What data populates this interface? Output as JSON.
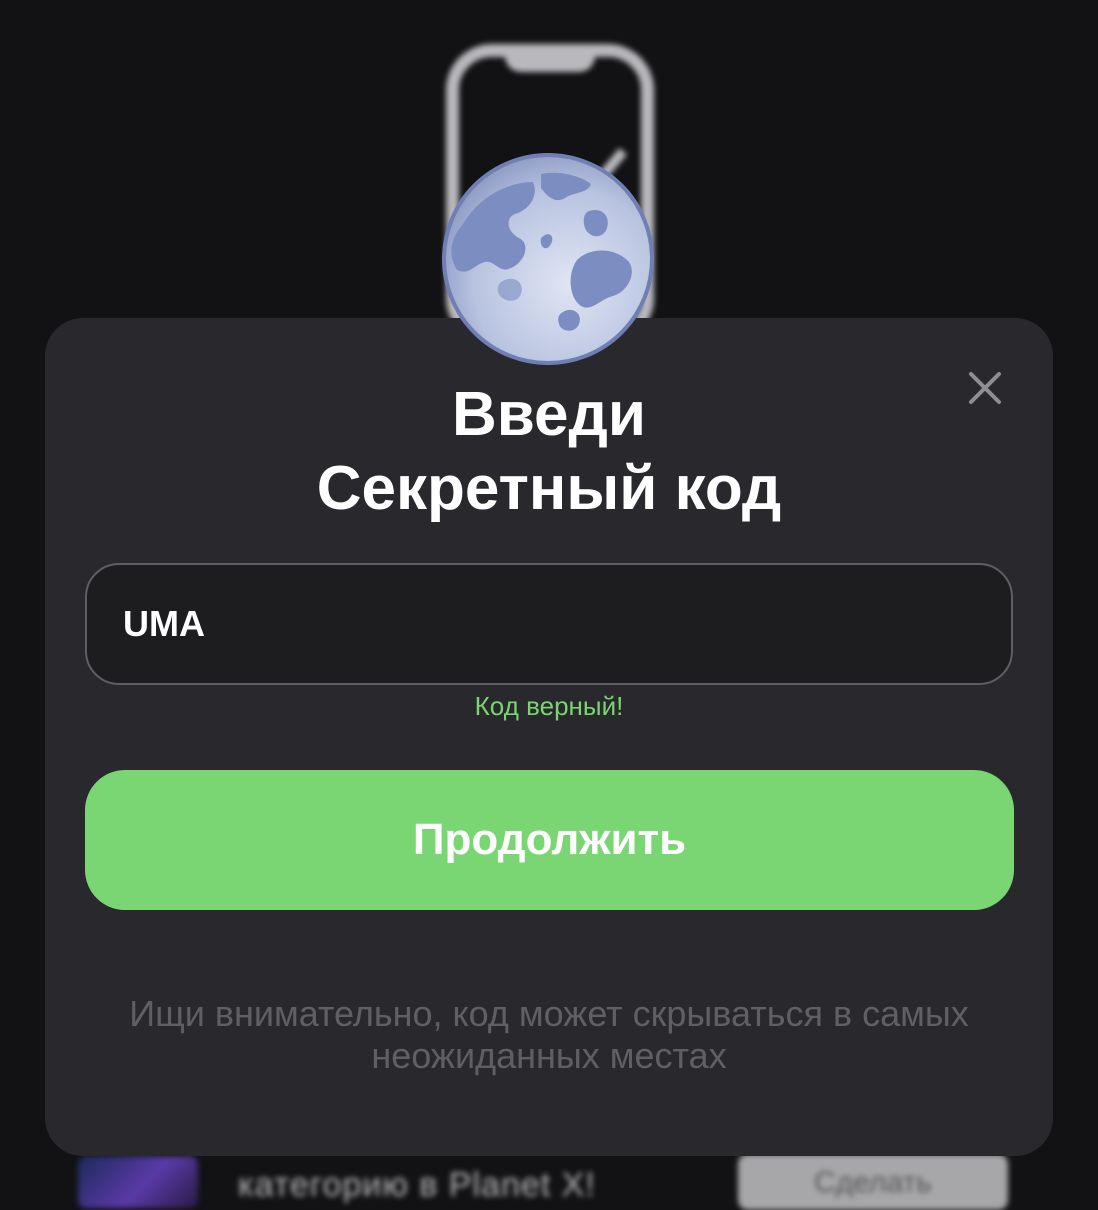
{
  "background": {
    "illustration_icon": "phone-check-icon",
    "bottom_card_text": "категорию в Planet X!",
    "bottom_card_button": "Сделать"
  },
  "modal": {
    "avatar_icon": "moon-icon",
    "close_icon": "close-icon",
    "title_line1": "Введи",
    "title_line2": "Секретный код",
    "input_value": "UMA",
    "status": "Код верный!",
    "continue_label": "Продолжить",
    "hint": "Ищи внимательно, код может скрываться в самых неожиданных местах"
  },
  "colors": {
    "background": "#121214",
    "modal": "#29292d",
    "accent_green": "#79d672",
    "status_green": "#78d56f",
    "hint_gray": "#5f5f64"
  }
}
